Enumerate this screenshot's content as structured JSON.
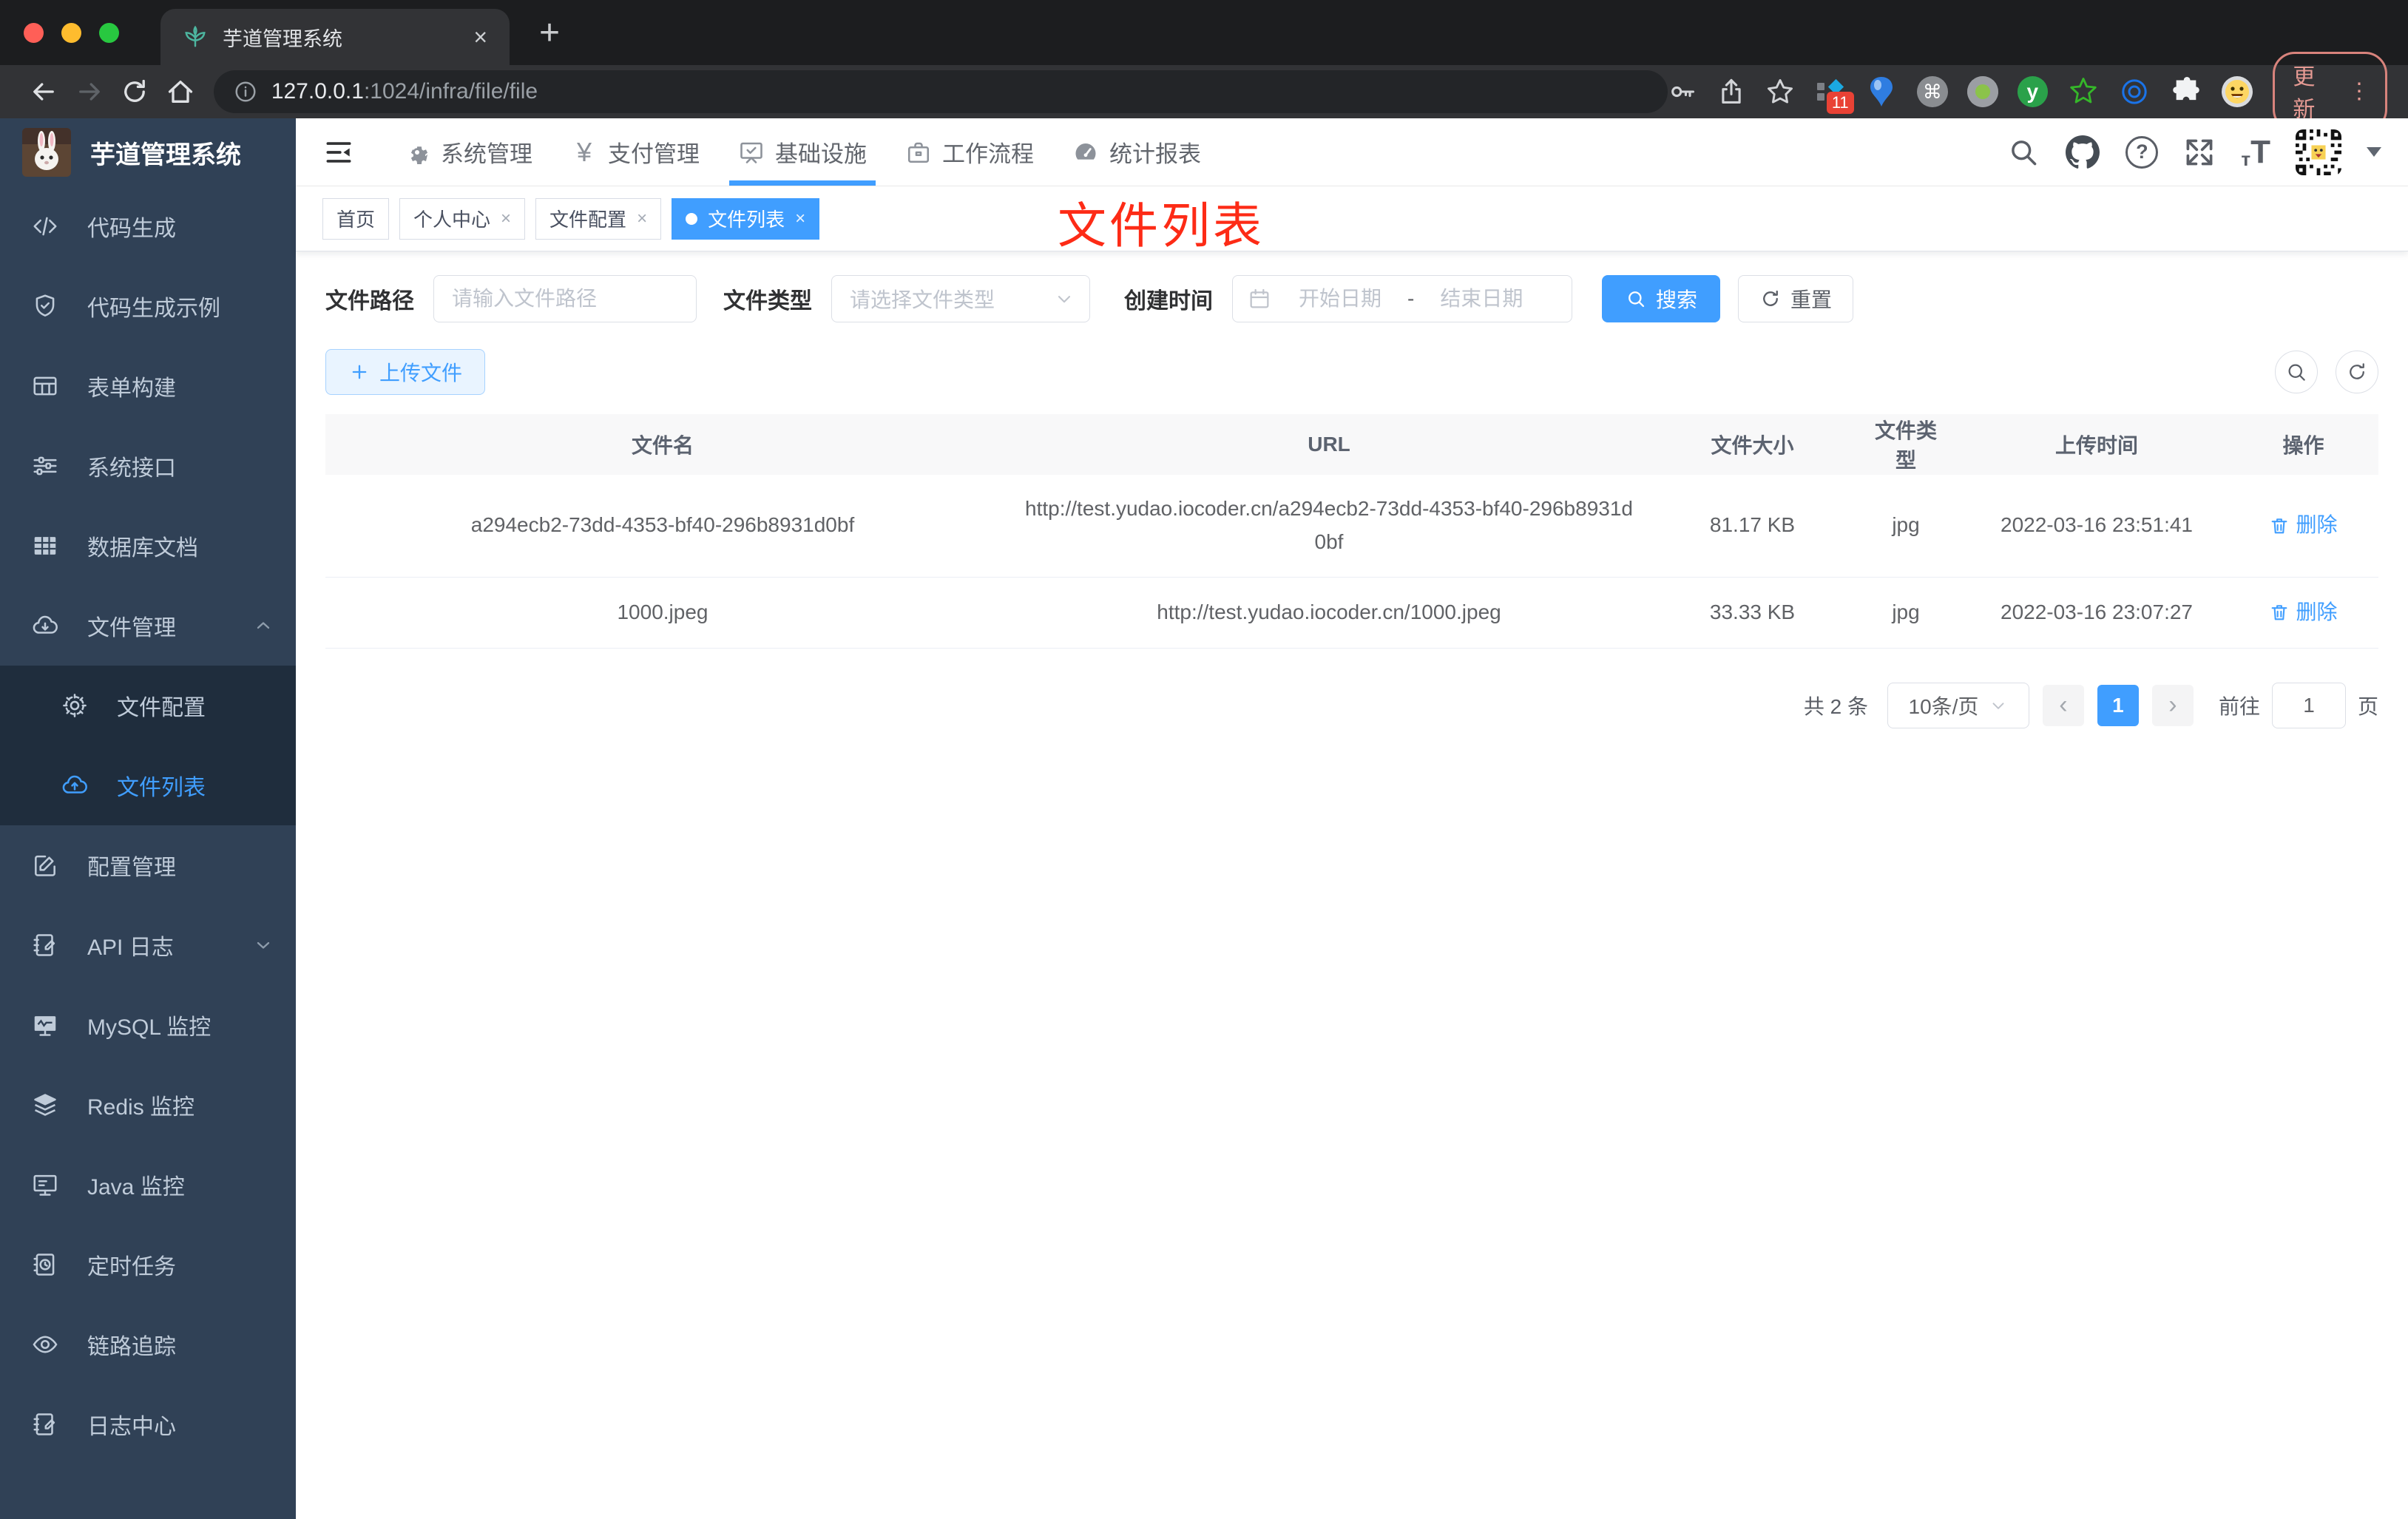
{
  "colors": {
    "accent": "#409eff",
    "annotation_red": "#fd2b16",
    "sidebar_bg": "#304156",
    "submenu_bg": "#1f2d3d",
    "danger_badge": "#e94235"
  },
  "browser": {
    "tab_title": "芋道管理系统",
    "close_glyph": "×",
    "newtab_glyph": "+",
    "url_host": "127.0.0.1",
    "url_rest": ":1024/infra/file/file",
    "extension_badge": "11",
    "cmd_glyph": "⌘",
    "y_glyph": "y",
    "update_label": "更新",
    "menu_dots_glyph": "⋮"
  },
  "header": {
    "nav": [
      {
        "label": "系统管理"
      },
      {
        "label": "支付管理",
        "icon_char": "¥"
      },
      {
        "label": "基础设施"
      },
      {
        "label": "工作流程"
      },
      {
        "label": "统计报表"
      }
    ],
    "help_glyph": "?",
    "font_small_glyph": "т",
    "font_big_glyph": "T"
  },
  "sidebar": {
    "title": "芋道管理系统",
    "items": [
      {
        "label": "代码生成"
      },
      {
        "label": "代码生成示例"
      },
      {
        "label": "表单构建"
      },
      {
        "label": "系统接口"
      },
      {
        "label": "数据库文档"
      },
      {
        "label": "文件管理"
      },
      {
        "label": "文件配置"
      },
      {
        "label": "文件列表"
      },
      {
        "label": "配置管理"
      },
      {
        "label": "API 日志"
      },
      {
        "label": "MySQL 监控"
      },
      {
        "label": "Redis 监控"
      },
      {
        "label": "Java 监控"
      },
      {
        "label": "定时任务"
      },
      {
        "label": "链路追踪"
      },
      {
        "label": "日志中心"
      }
    ]
  },
  "tags": {
    "items": [
      {
        "label": "首页"
      },
      {
        "label": "个人中心"
      },
      {
        "label": "文件配置"
      },
      {
        "label": "文件列表"
      }
    ],
    "close_glyph": "×"
  },
  "annotation": "文件列表",
  "filters": {
    "path_label": "文件路径",
    "path_placeholder": "请输入文件路径",
    "type_label": "文件类型",
    "type_placeholder": "请选择文件类型",
    "date_label": "创建时间",
    "date_start_placeholder": "开始日期",
    "date_separator": "-",
    "date_end_placeholder": "结束日期",
    "search_label": "搜索",
    "reset_label": "重置"
  },
  "toolbar": {
    "upload_label": "上传文件"
  },
  "table": {
    "headers": [
      "文件名",
      "URL",
      "文件大小",
      "文件类型",
      "上传时间",
      "操作"
    ],
    "rows": [
      {
        "name": "a294ecb2-73dd-4353-bf40-296b8931d0bf",
        "url": "http://test.yudao.iocoder.cn/a294ecb2-73dd-4353-bf40-296b8931d0bf",
        "size": "81.17 KB",
        "type": "jpg",
        "time": "2022-03-16 23:51:41",
        "action": "删除"
      },
      {
        "name": "1000.jpeg",
        "url": "http://test.yudao.iocoder.cn/1000.jpeg",
        "size": "33.33 KB",
        "type": "jpg",
        "time": "2022-03-16 23:07:27",
        "action": "删除"
      }
    ]
  },
  "pagination": {
    "total": "共 2 条",
    "page_size": "10条/页",
    "prev_glyph": "‹",
    "current_page": "1",
    "next_glyph": "›",
    "goto_label": "前往",
    "goto_value": "1",
    "unit_label": "页"
  }
}
